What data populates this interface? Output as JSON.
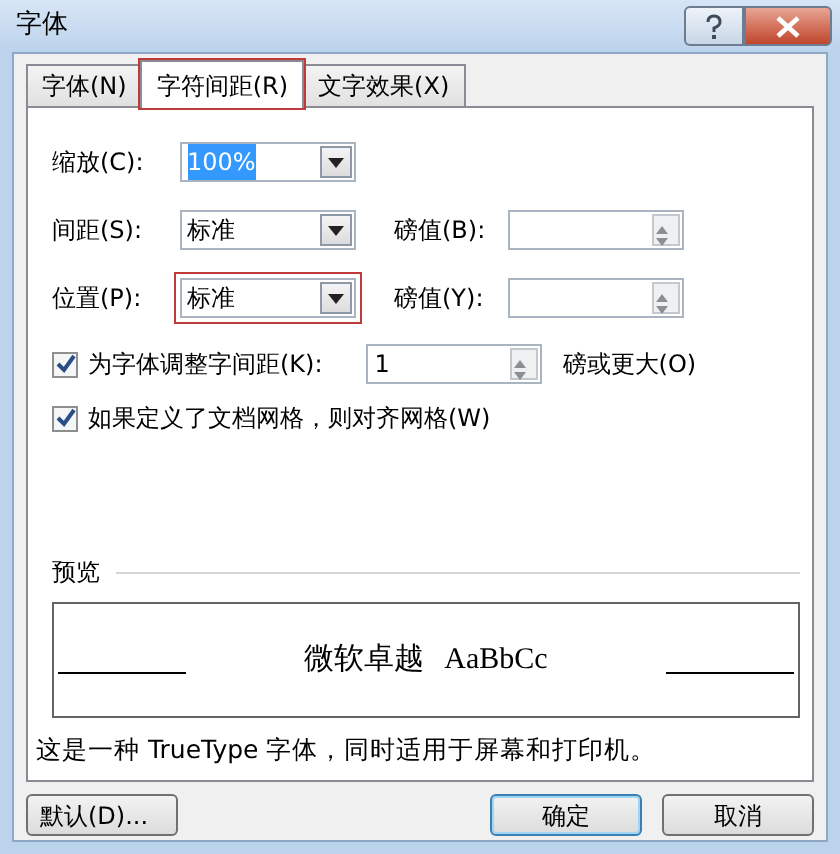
{
  "window": {
    "title": "字体"
  },
  "tabs": [
    {
      "label": "字体(N)",
      "selected": false,
      "highlighted": false
    },
    {
      "label": "字符间距(R)",
      "selected": true,
      "highlighted": true
    },
    {
      "label": "文字效果(X)",
      "selected": false,
      "highlighted": false
    }
  ],
  "rows": [
    {
      "label": "缩放(C):",
      "value": "100%",
      "text_selected": true,
      "highlighted": false
    },
    {
      "label": "间距(S):",
      "value": "标准",
      "text_selected": false,
      "highlighted": false,
      "points_label": "磅值(B):"
    },
    {
      "label": "位置(P):",
      "value": "标准",
      "text_selected": false,
      "highlighted": true,
      "points_label": "磅值(Y):"
    }
  ],
  "checks": [
    {
      "label": "为字体调整字间距(K):",
      "checked": true,
      "spin_value": "1",
      "suffix": "磅或更大(O)"
    },
    {
      "label": "如果定义了文档网格，则对齐网格(W)",
      "checked": true
    }
  ],
  "preview": {
    "heading": "预览",
    "sample_cjk": "微软卓越",
    "sample_latin": "AaBbCc"
  },
  "description": "这是一种 TrueType 字体，同时适用于屏幕和打印机。",
  "buttons": [
    {
      "label": "默认(D)...",
      "kind": "default"
    },
    {
      "label": "确定",
      "kind": "ok"
    },
    {
      "label": "取消",
      "kind": "cancel"
    }
  ]
}
